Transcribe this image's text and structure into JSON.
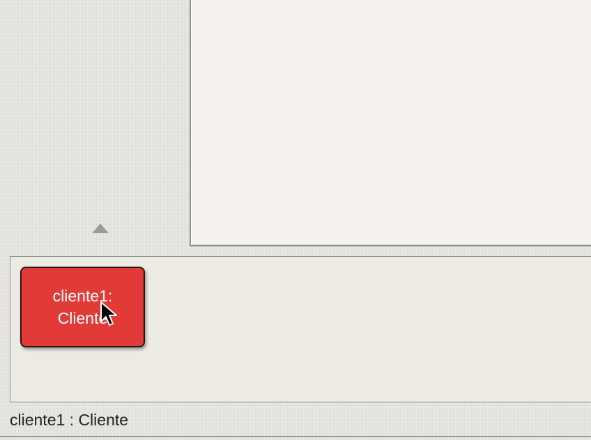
{
  "object_bench": {
    "objects": [
      {
        "name_line": "cliente1:",
        "class_line": "Cliente",
        "color": "#e23a37"
      }
    ]
  },
  "status_bar": {
    "text": "cliente1 : Cliente"
  },
  "icons": {
    "collapse": "triangle-up-icon",
    "pointer": "mouse-pointer-icon"
  }
}
